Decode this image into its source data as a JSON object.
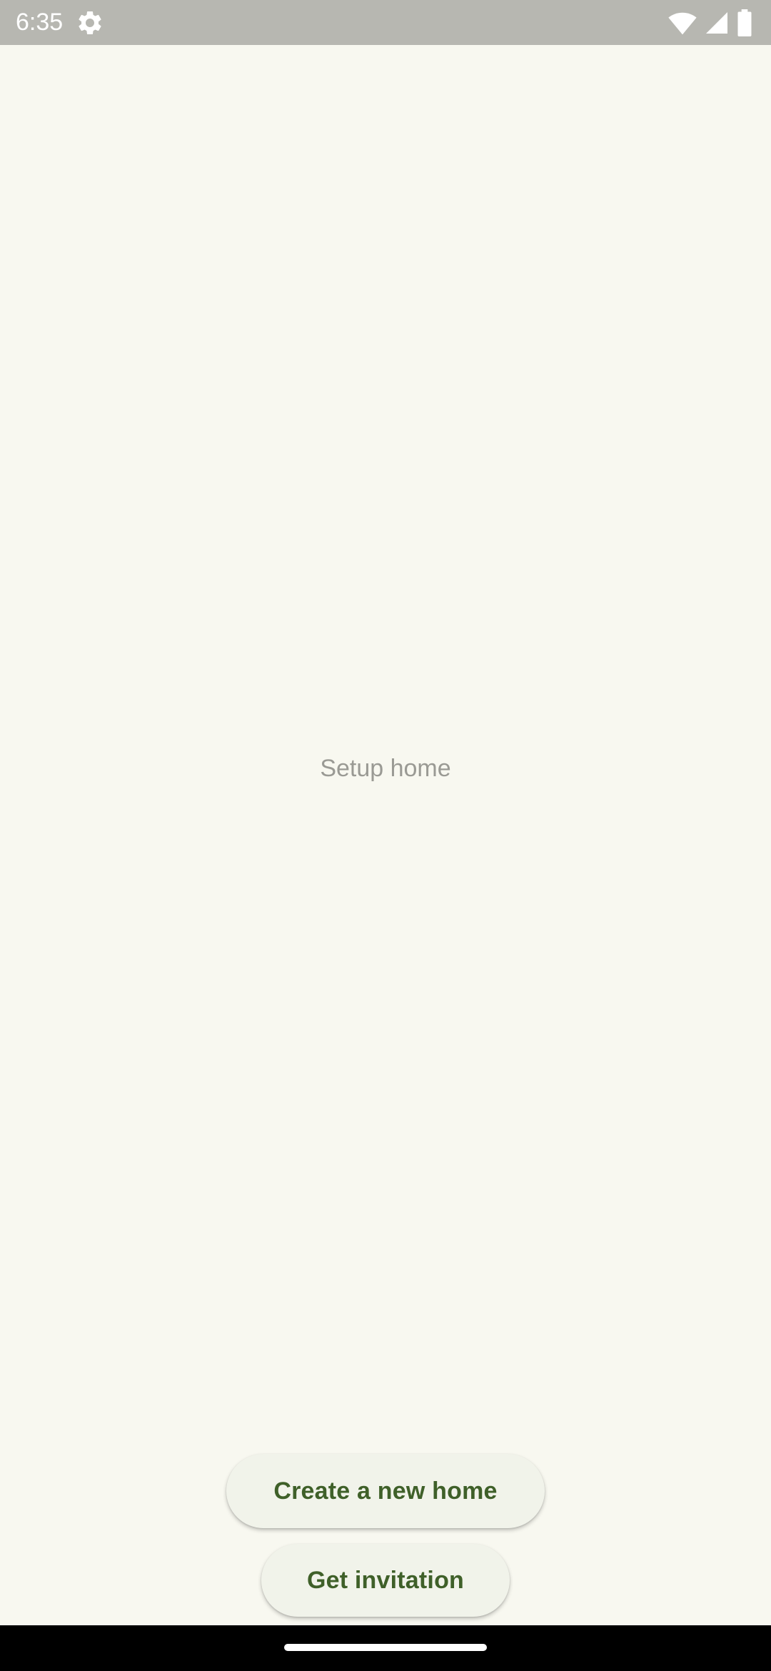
{
  "status_bar": {
    "time": "6:35",
    "icons": [
      "settings-gear-icon",
      "wifi-icon",
      "cellular-signal-icon",
      "battery-icon"
    ],
    "background": "#b7b7b1"
  },
  "main": {
    "label": "Setup home"
  },
  "actions": {
    "create_label": "Create a new home",
    "invite_label": "Get invitation"
  },
  "colors": {
    "background": "#f8f8f0",
    "button_background": "#f1f3ea",
    "button_text": "#3f6029",
    "label_text": "#9a9a94",
    "nav_bar": "#000000"
  }
}
